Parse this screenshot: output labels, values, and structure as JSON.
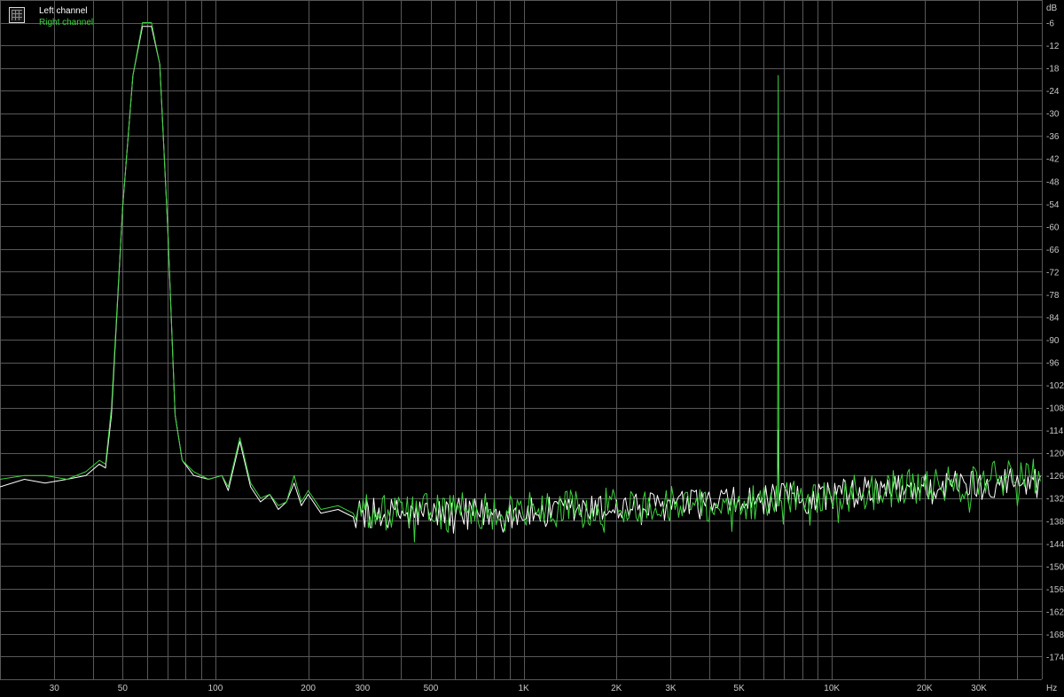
{
  "colors": {
    "background": "#000000",
    "grid": "#585858",
    "left_channel": "#ffffff",
    "right_channel": "#3cd23c",
    "text": "#c8c8c8"
  },
  "legend": {
    "icon": "grid-window-icon",
    "left_label": "Left channel",
    "right_label": "Right channel"
  },
  "chart_data": {
    "type": "line",
    "x_scale": "log",
    "xlim": [
      20,
      48000
    ],
    "ylim": [
      -180,
      0
    ],
    "y_unit": "dB",
    "x_unit": "Hz",
    "grid": true,
    "legend_position": "top-left",
    "y_ticks": [
      -6,
      -12,
      -18,
      -24,
      -30,
      -36,
      -42,
      -48,
      -54,
      -60,
      -66,
      -72,
      -78,
      -84,
      -90,
      -96,
      -102,
      -108,
      -114,
      -120,
      -126,
      -132,
      -138,
      -144,
      -150,
      -156,
      -162,
      -168,
      -174
    ],
    "x_ticks": [
      {
        "value": 30,
        "label": "30"
      },
      {
        "value": 50,
        "label": "50"
      },
      {
        "value": 100,
        "label": "100"
      },
      {
        "value": 200,
        "label": "200"
      },
      {
        "value": 300,
        "label": "300"
      },
      {
        "value": 500,
        "label": "500"
      },
      {
        "value": 1000,
        "label": "1K"
      },
      {
        "value": 2000,
        "label": "2K"
      },
      {
        "value": 3000,
        "label": "3K"
      },
      {
        "value": 5000,
        "label": "5K"
      },
      {
        "value": 10000,
        "label": "10K"
      },
      {
        "value": 20000,
        "label": "20K"
      },
      {
        "value": 30000,
        "label": "30K"
      }
    ],
    "series": [
      {
        "name": "Left channel",
        "color": "#ffffff",
        "peaks": [
          [
            20,
            -129
          ],
          [
            24,
            -127
          ],
          [
            28,
            -128
          ],
          [
            33,
            -127
          ],
          [
            38,
            -126
          ],
          [
            42,
            -123
          ],
          [
            44,
            -124
          ],
          [
            46,
            -110
          ],
          [
            50,
            -55
          ],
          [
            54,
            -20
          ],
          [
            58,
            -7
          ],
          [
            62,
            -7
          ],
          [
            66,
            -17
          ],
          [
            70,
            -60
          ],
          [
            74,
            -110
          ],
          [
            78,
            -122
          ],
          [
            85,
            -126
          ],
          [
            95,
            -127
          ],
          [
            105,
            -126
          ],
          [
            110,
            -130
          ],
          [
            120,
            -117
          ],
          [
            130,
            -129
          ],
          [
            140,
            -133
          ],
          [
            150,
            -131
          ],
          [
            160,
            -135
          ],
          [
            170,
            -133
          ],
          [
            180,
            -128
          ],
          [
            190,
            -134
          ],
          [
            200,
            -131
          ],
          [
            220,
            -136
          ],
          [
            250,
            -135
          ],
          [
            280,
            -137
          ]
        ],
        "noise_floor": [
          [
            280,
            -136
          ],
          [
            1000,
            -136
          ],
          [
            5000,
            -133
          ],
          [
            20000,
            -129
          ],
          [
            45000,
            -127
          ]
        ],
        "noise_amplitude_db": 4,
        "extra_peaks": [
          [
            6700,
            -114
          ]
        ]
      },
      {
        "name": "Right channel",
        "color": "#3cd23c",
        "peaks": [
          [
            20,
            -127
          ],
          [
            24,
            -126
          ],
          [
            28,
            -126
          ],
          [
            33,
            -127
          ],
          [
            38,
            -125
          ],
          [
            42,
            -122
          ],
          [
            44,
            -123
          ],
          [
            46,
            -108
          ],
          [
            50,
            -55
          ],
          [
            54,
            -20
          ],
          [
            58,
            -6
          ],
          [
            62,
            -6
          ],
          [
            66,
            -17
          ],
          [
            70,
            -60
          ],
          [
            74,
            -110
          ],
          [
            78,
            -122
          ],
          [
            85,
            -125
          ],
          [
            95,
            -127
          ],
          [
            105,
            -126
          ],
          [
            110,
            -129
          ],
          [
            120,
            -116
          ],
          [
            130,
            -128
          ],
          [
            140,
            -132
          ],
          [
            150,
            -131
          ],
          [
            160,
            -134
          ],
          [
            170,
            -133
          ],
          [
            180,
            -126
          ],
          [
            190,
            -133
          ],
          [
            200,
            -130
          ],
          [
            220,
            -135
          ],
          [
            250,
            -134
          ],
          [
            280,
            -136
          ]
        ],
        "noise_floor": [
          [
            280,
            -136
          ],
          [
            1000,
            -135
          ],
          [
            5000,
            -133
          ],
          [
            20000,
            -129
          ],
          [
            45000,
            -126
          ]
        ],
        "noise_amplitude_db": 5,
        "extra_peaks": [
          [
            6700,
            -20
          ]
        ]
      }
    ]
  }
}
